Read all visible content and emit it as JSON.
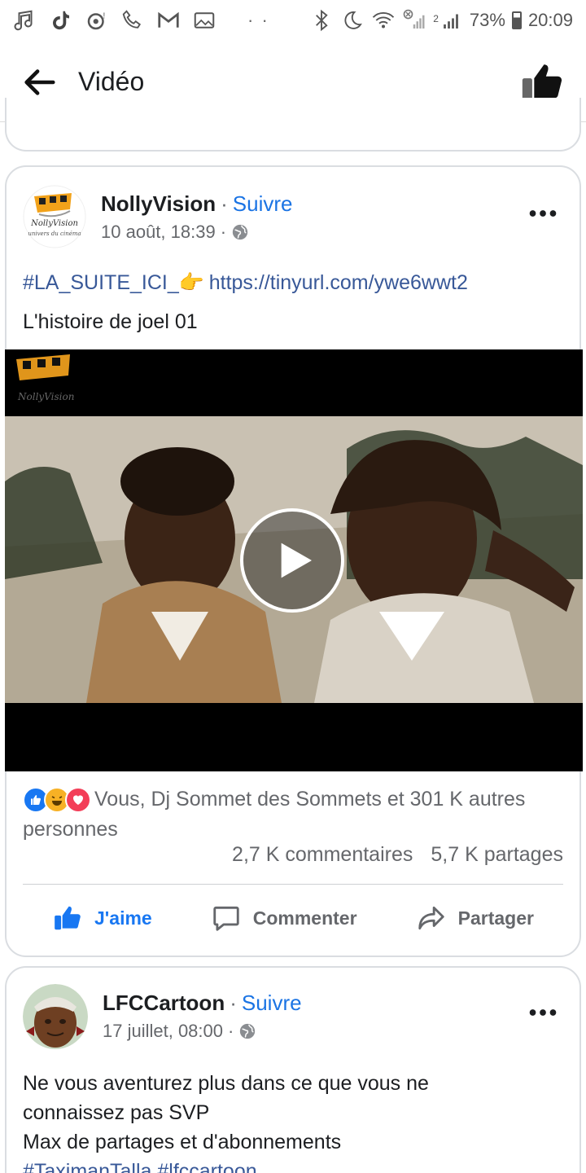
{
  "status_bar": {
    "dots": "· ·",
    "battery": "73%",
    "time": "20:09",
    "network_tag": "2"
  },
  "app_bar": {
    "title": "Vidéo"
  },
  "posts": [
    {
      "page_name": "NollyVision",
      "separator": "·",
      "follow_label": "Suivre",
      "date": "10 août, 18:39",
      "meta_sep": "·",
      "avatar_brand": "NollyVision",
      "avatar_sub": "univers du cinéma",
      "hashtag": "#LA_SUITE_ICI_",
      "emoji": "👉",
      "link": "https://tinyurl.com/ywe6wwt2",
      "text": "L'histoire de joel 01",
      "reactions_text": "Vous, Dj Sommet des Sommets et 301 K autres personnes",
      "comments_count": "2,7 K commentaires",
      "shares_count": "5,7 K partages",
      "actions": {
        "like": "J'aime",
        "comment": "Commenter",
        "share": "Partager"
      }
    },
    {
      "page_name": "LFCCartoon",
      "separator": "·",
      "follow_label": "Suivre",
      "date": "17 juillet, 08:00",
      "meta_sep": "·",
      "text_lines": [
        "Ne vous aventurez plus dans ce que vous ne",
        "connaissez pas SVP",
        "Max de partages et d'abonnements",
        "#TaximanTalla #lfccartoon"
      ]
    }
  ],
  "colors": {
    "facebook_blue": "#1877f2",
    "link_blue": "#385898",
    "meta_gray": "#65676b"
  }
}
